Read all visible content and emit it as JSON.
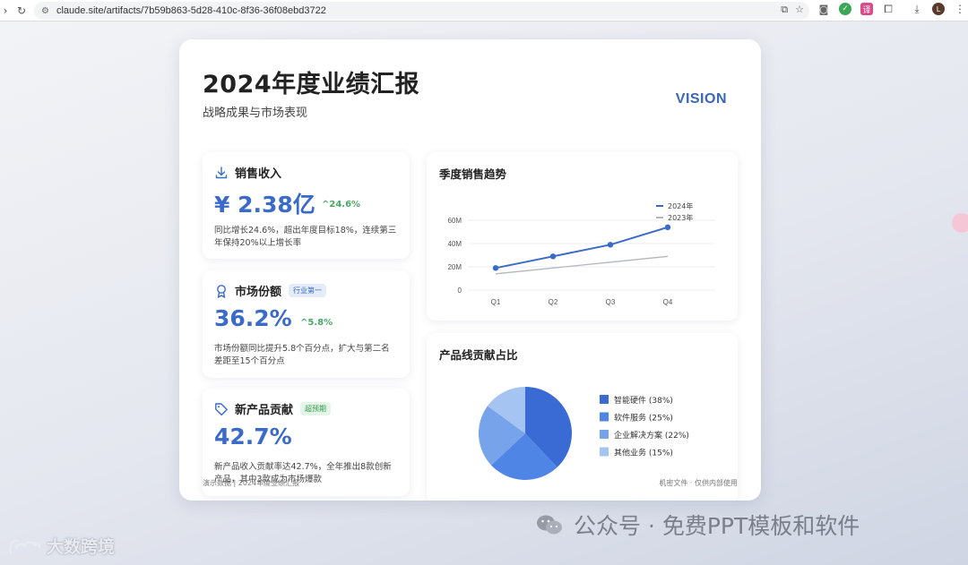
{
  "browser": {
    "url": "claude.site/artifacts/7b59b863-5d28-410c-8f36-36f08ebd3722"
  },
  "slide": {
    "title": "2024年度业绩汇报",
    "subtitle": "战略成果与市场表现",
    "brand": "VISION",
    "footer_left": "演示数据 | 2024年度业绩汇报",
    "footer_right": "机密文件 · 仅供内部使用"
  },
  "kpis": [
    {
      "title": "销售收入",
      "value": "¥ 2.38亿",
      "change": "^24.6%",
      "tag": "",
      "desc": "同比增长24.6%，超出年度目标18%，连续第三年保持20%以上增长率"
    },
    {
      "title": "市场份额",
      "value": "36.2%",
      "change": "^5.8%",
      "tag": "行业第一",
      "desc": "市场份额同比提升5.8个百分点，扩大与第二名差距至15个百分点"
    },
    {
      "title": "新产品贡献",
      "value": "42.7%",
      "change": "",
      "tag": "超预期",
      "desc": "新产品收入贡献率达42.7%，全年推出8款创新产品，其中3款成为市场爆款"
    }
  ],
  "trend": {
    "title": "季度销售趋势"
  },
  "pie": {
    "title": "产品线贡献占比"
  },
  "chart_data": [
    {
      "type": "line",
      "title": "季度销售趋势",
      "categories": [
        "Q1",
        "Q2",
        "Q3",
        "Q4"
      ],
      "y_ticks": [
        "0",
        "20M",
        "40M",
        "60M"
      ],
      "ylim": [
        0,
        60
      ],
      "series": [
        {
          "name": "2024年",
          "values": [
            19,
            29,
            39,
            54
          ],
          "color": "#3a6bc8"
        },
        {
          "name": "2023年",
          "values": [
            14,
            19,
            24,
            29
          ],
          "color": "#b3b7bf"
        }
      ],
      "legend": "top-right",
      "grid": true
    },
    {
      "type": "pie",
      "title": "产品线贡献占比",
      "slices": [
        {
          "label": "智能硬件 (38%)",
          "value": 38,
          "color": "#3a6bd4"
        },
        {
          "label": "软件服务 (25%)",
          "value": 25,
          "color": "#4f85e4"
        },
        {
          "label": "企业解决方案 (22%)",
          "value": 22,
          "color": "#77a3ea"
        },
        {
          "label": "其他业务 (15%)",
          "value": 15,
          "color": "#a6c4f1"
        }
      ],
      "legend": "right"
    }
  ],
  "watermarks": {
    "right": "公众号 · 免费PPT模板和软件",
    "left": "大数跨境"
  }
}
